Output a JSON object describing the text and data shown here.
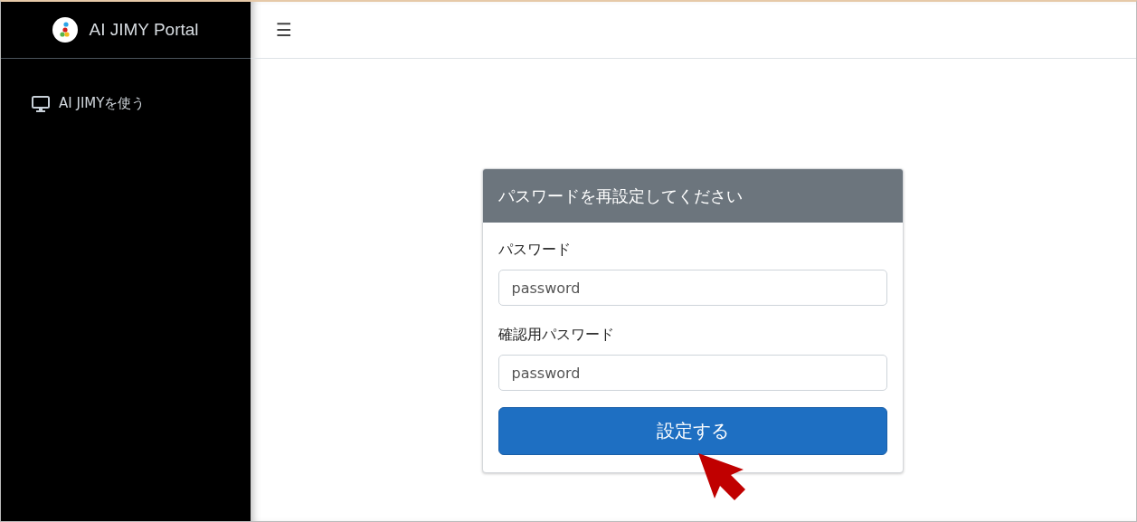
{
  "brand": {
    "title": "AI JIMY Portal"
  },
  "topbar": {
    "menu_icon": "☰"
  },
  "sidebar": {
    "items": [
      {
        "label": "AI JIMYを使う",
        "selected": false
      }
    ]
  },
  "card": {
    "title": "パスワードを再設定してください",
    "fields": [
      {
        "label": "パスワード",
        "placeholder": "password"
      },
      {
        "label": "確認用パスワード",
        "placeholder": "password"
      }
    ],
    "submit": "設定する"
  }
}
